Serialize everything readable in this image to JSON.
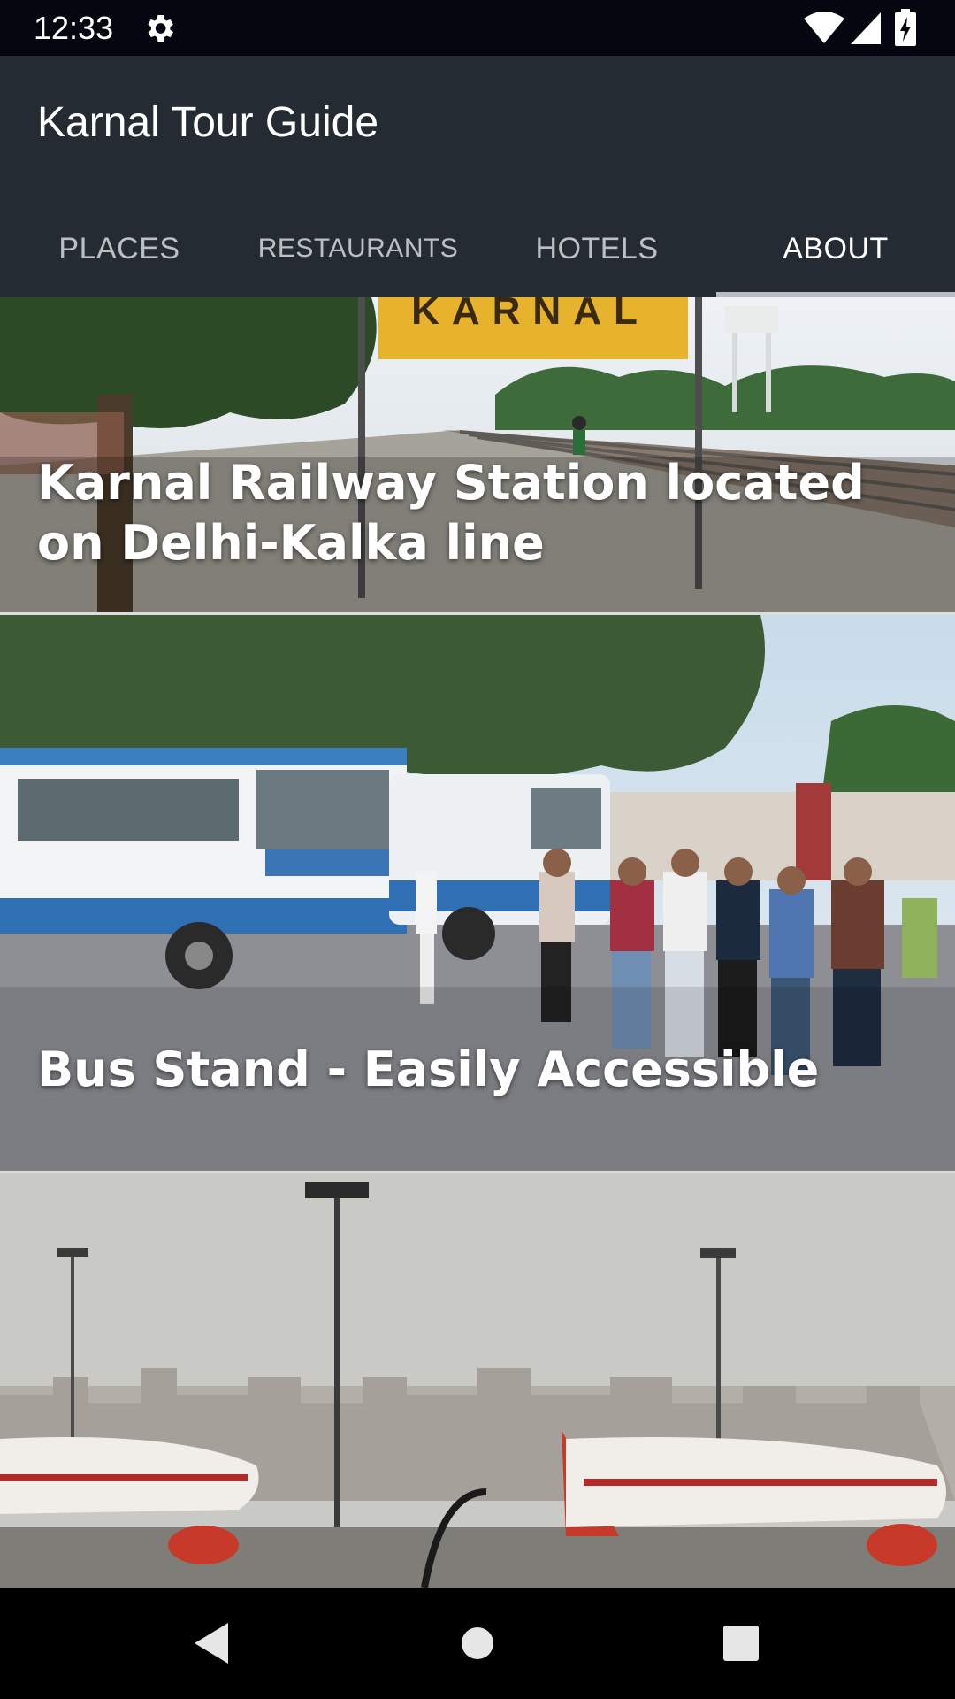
{
  "status_bar": {
    "time": "12:33",
    "icons": [
      "gear-icon",
      "wifi-icon",
      "signal-icon",
      "battery-charging-icon"
    ]
  },
  "app": {
    "title": "Karnal Tour Guide",
    "tabs": [
      {
        "label": "PLACES",
        "active": false
      },
      {
        "label": "RESTAURANTS",
        "active": false
      },
      {
        "label": "HOTELS",
        "active": false
      },
      {
        "label": "ABOUT",
        "active": true
      }
    ]
  },
  "cards": [
    {
      "caption": "Karnal Railway Station located on Delhi-Kalka line"
    },
    {
      "caption": "Bus Stand - Easily Accessible"
    },
    {
      "caption": ""
    }
  ],
  "nav_bar": {
    "icons": [
      "back-icon",
      "home-icon",
      "recents-icon"
    ]
  },
  "colors": {
    "status_bar": "#040710",
    "app_bar": "#242b33",
    "tab_indicator": "#b7bcc2"
  }
}
